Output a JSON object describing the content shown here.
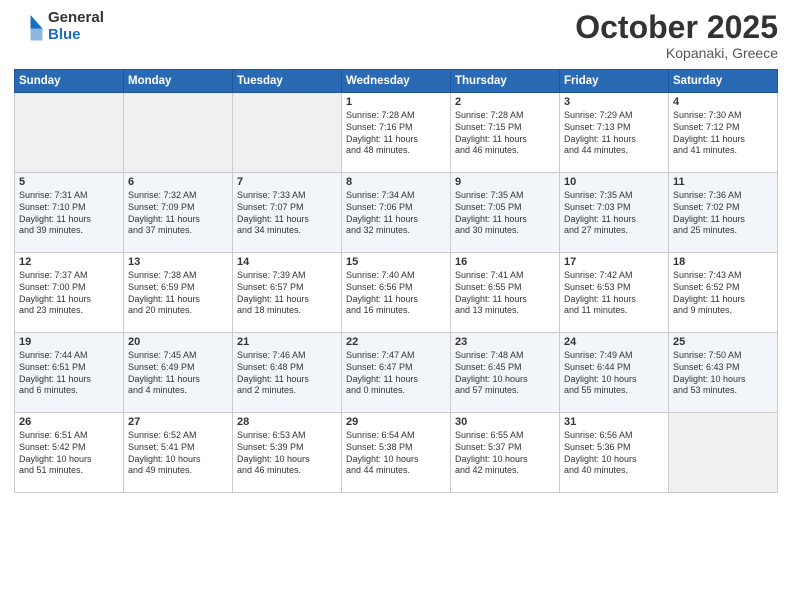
{
  "header": {
    "logo_general": "General",
    "logo_blue": "Blue",
    "month": "October 2025",
    "location": "Kopanaki, Greece"
  },
  "weekdays": [
    "Sunday",
    "Monday",
    "Tuesday",
    "Wednesday",
    "Thursday",
    "Friday",
    "Saturday"
  ],
  "weeks": [
    [
      {
        "day": "",
        "info": ""
      },
      {
        "day": "",
        "info": ""
      },
      {
        "day": "",
        "info": ""
      },
      {
        "day": "1",
        "info": "Sunrise: 7:28 AM\nSunset: 7:16 PM\nDaylight: 11 hours\nand 48 minutes."
      },
      {
        "day": "2",
        "info": "Sunrise: 7:28 AM\nSunset: 7:15 PM\nDaylight: 11 hours\nand 46 minutes."
      },
      {
        "day": "3",
        "info": "Sunrise: 7:29 AM\nSunset: 7:13 PM\nDaylight: 11 hours\nand 44 minutes."
      },
      {
        "day": "4",
        "info": "Sunrise: 7:30 AM\nSunset: 7:12 PM\nDaylight: 11 hours\nand 41 minutes."
      }
    ],
    [
      {
        "day": "5",
        "info": "Sunrise: 7:31 AM\nSunset: 7:10 PM\nDaylight: 11 hours\nand 39 minutes."
      },
      {
        "day": "6",
        "info": "Sunrise: 7:32 AM\nSunset: 7:09 PM\nDaylight: 11 hours\nand 37 minutes."
      },
      {
        "day": "7",
        "info": "Sunrise: 7:33 AM\nSunset: 7:07 PM\nDaylight: 11 hours\nand 34 minutes."
      },
      {
        "day": "8",
        "info": "Sunrise: 7:34 AM\nSunset: 7:06 PM\nDaylight: 11 hours\nand 32 minutes."
      },
      {
        "day": "9",
        "info": "Sunrise: 7:35 AM\nSunset: 7:05 PM\nDaylight: 11 hours\nand 30 minutes."
      },
      {
        "day": "10",
        "info": "Sunrise: 7:35 AM\nSunset: 7:03 PM\nDaylight: 11 hours\nand 27 minutes."
      },
      {
        "day": "11",
        "info": "Sunrise: 7:36 AM\nSunset: 7:02 PM\nDaylight: 11 hours\nand 25 minutes."
      }
    ],
    [
      {
        "day": "12",
        "info": "Sunrise: 7:37 AM\nSunset: 7:00 PM\nDaylight: 11 hours\nand 23 minutes."
      },
      {
        "day": "13",
        "info": "Sunrise: 7:38 AM\nSunset: 6:59 PM\nDaylight: 11 hours\nand 20 minutes."
      },
      {
        "day": "14",
        "info": "Sunrise: 7:39 AM\nSunset: 6:57 PM\nDaylight: 11 hours\nand 18 minutes."
      },
      {
        "day": "15",
        "info": "Sunrise: 7:40 AM\nSunset: 6:56 PM\nDaylight: 11 hours\nand 16 minutes."
      },
      {
        "day": "16",
        "info": "Sunrise: 7:41 AM\nSunset: 6:55 PM\nDaylight: 11 hours\nand 13 minutes."
      },
      {
        "day": "17",
        "info": "Sunrise: 7:42 AM\nSunset: 6:53 PM\nDaylight: 11 hours\nand 11 minutes."
      },
      {
        "day": "18",
        "info": "Sunrise: 7:43 AM\nSunset: 6:52 PM\nDaylight: 11 hours\nand 9 minutes."
      }
    ],
    [
      {
        "day": "19",
        "info": "Sunrise: 7:44 AM\nSunset: 6:51 PM\nDaylight: 11 hours\nand 6 minutes."
      },
      {
        "day": "20",
        "info": "Sunrise: 7:45 AM\nSunset: 6:49 PM\nDaylight: 11 hours\nand 4 minutes."
      },
      {
        "day": "21",
        "info": "Sunrise: 7:46 AM\nSunset: 6:48 PM\nDaylight: 11 hours\nand 2 minutes."
      },
      {
        "day": "22",
        "info": "Sunrise: 7:47 AM\nSunset: 6:47 PM\nDaylight: 11 hours\nand 0 minutes."
      },
      {
        "day": "23",
        "info": "Sunrise: 7:48 AM\nSunset: 6:45 PM\nDaylight: 10 hours\nand 57 minutes."
      },
      {
        "day": "24",
        "info": "Sunrise: 7:49 AM\nSunset: 6:44 PM\nDaylight: 10 hours\nand 55 minutes."
      },
      {
        "day": "25",
        "info": "Sunrise: 7:50 AM\nSunset: 6:43 PM\nDaylight: 10 hours\nand 53 minutes."
      }
    ],
    [
      {
        "day": "26",
        "info": "Sunrise: 6:51 AM\nSunset: 5:42 PM\nDaylight: 10 hours\nand 51 minutes."
      },
      {
        "day": "27",
        "info": "Sunrise: 6:52 AM\nSunset: 5:41 PM\nDaylight: 10 hours\nand 49 minutes."
      },
      {
        "day": "28",
        "info": "Sunrise: 6:53 AM\nSunset: 5:39 PM\nDaylight: 10 hours\nand 46 minutes."
      },
      {
        "day": "29",
        "info": "Sunrise: 6:54 AM\nSunset: 5:38 PM\nDaylight: 10 hours\nand 44 minutes."
      },
      {
        "day": "30",
        "info": "Sunrise: 6:55 AM\nSunset: 5:37 PM\nDaylight: 10 hours\nand 42 minutes."
      },
      {
        "day": "31",
        "info": "Sunrise: 6:56 AM\nSunset: 5:36 PM\nDaylight: 10 hours\nand 40 minutes."
      },
      {
        "day": "",
        "info": ""
      }
    ]
  ]
}
